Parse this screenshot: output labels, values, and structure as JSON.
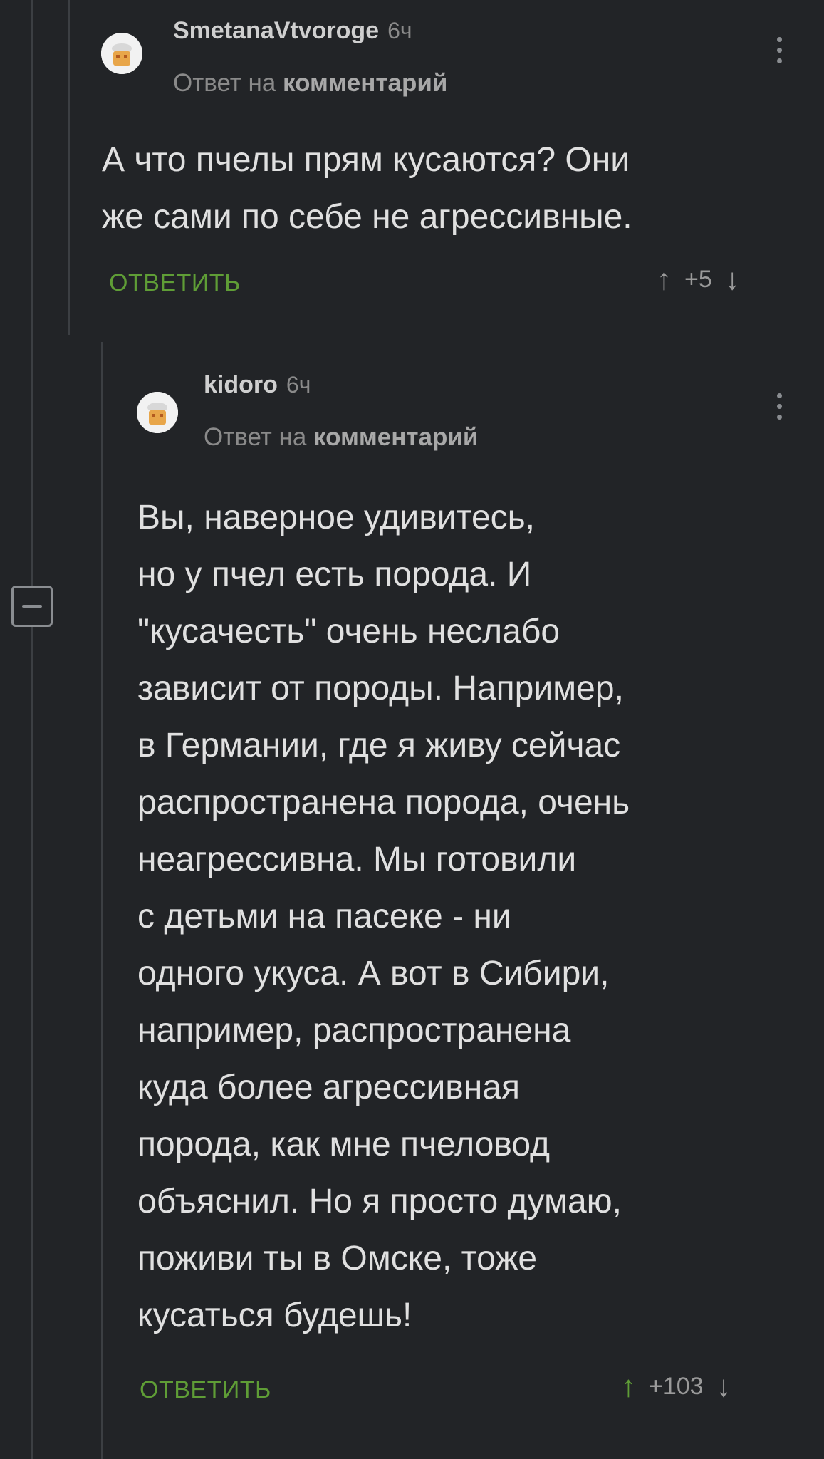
{
  "comments": [
    {
      "author": "SmetanaVtvoroge",
      "time": "6ч",
      "reply_prefix": "Ответ на",
      "reply_link": "комментарий",
      "text": "А что пчелы прям кусаются? Они\nже сами по себе не агрессивные.",
      "reply_label": "ОТВЕТИТЬ",
      "rating": "+5",
      "upvoted": false
    },
    {
      "author": "kidoro",
      "time": "6ч",
      "reply_prefix": "Ответ на",
      "reply_link": "комментарий",
      "text": "Вы, наверное удивитесь,\nно у пчел есть порода. И\n\"кусачесть\" очень неслабо\nзависит от породы. Например,\nв Германии, где я живу сейчас\nраспространена порода, очень\nнеагрессивна. Мы готовили\nс детьми на пасеке - ни\nодного укуса. А вот в Сибири,\nнапример, распространена\nкуда более агрессивная\nпорода, как мне пчеловод\nобъяснил. Но я просто думаю,\nпоживи ты в Омске, тоже\nкусаться будешь!",
      "reply_label": "ОТВЕТИТЬ",
      "rating": "+103",
      "upvoted": true
    }
  ],
  "icons": {
    "upvote": "↑",
    "downvote": "↓",
    "more": "more-vertical-icon",
    "collapse": "minus-square-icon"
  },
  "colors": {
    "background": "#222427",
    "accent_green": "#5f9d36",
    "muted": "#8a8a8a"
  }
}
